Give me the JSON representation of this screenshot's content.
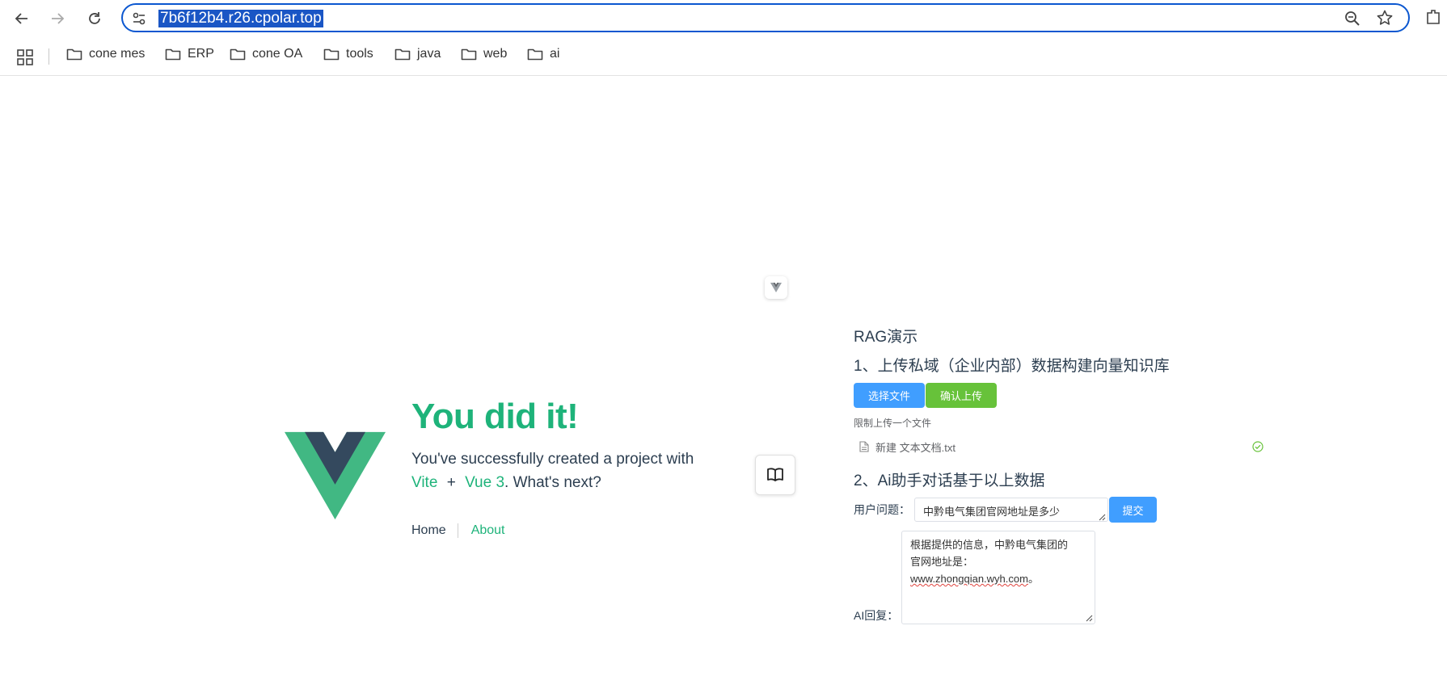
{
  "browser": {
    "url": "7b6f12b4.r26.cpolar.top",
    "bookmarks": [
      "cone mes",
      "ERP",
      "cone OA",
      "tools",
      "java",
      "web",
      "ai"
    ]
  },
  "hero": {
    "title": "You did it!",
    "subtitle_prefix": "You've successfully created a project with",
    "link_vite": "Vite",
    "plus": "+",
    "link_vue": "Vue 3",
    "subtitle_suffix": ". What's next?"
  },
  "nav": {
    "home": "Home",
    "about": "About"
  },
  "rag": {
    "title": "RAG演示",
    "step1": "1、上传私域（企业内部）数据构建向量知识库",
    "select_file": "选择文件",
    "confirm_upload": "确认上传",
    "upload_tip": "限制上传一个文件",
    "file_name": "新建 文本文档.txt",
    "step2": "2、Ai助手对话基于以上数据",
    "question_label": "用户问题：",
    "question_value": "中黔电气集团官网地址是多少",
    "submit": "提交",
    "answer_label": "AI回复：",
    "answer_line1": "根据提供的信息，中黔电气集团的",
    "answer_line2": "官网地址是：",
    "answer_url": "www.zhongqian.wyh.com",
    "answer_end": "。"
  },
  "colors": {
    "accent_green": "#1eb37a",
    "primary_blue": "#409eff",
    "success_green": "#67c23a",
    "url_highlight": "#1a56c5"
  }
}
